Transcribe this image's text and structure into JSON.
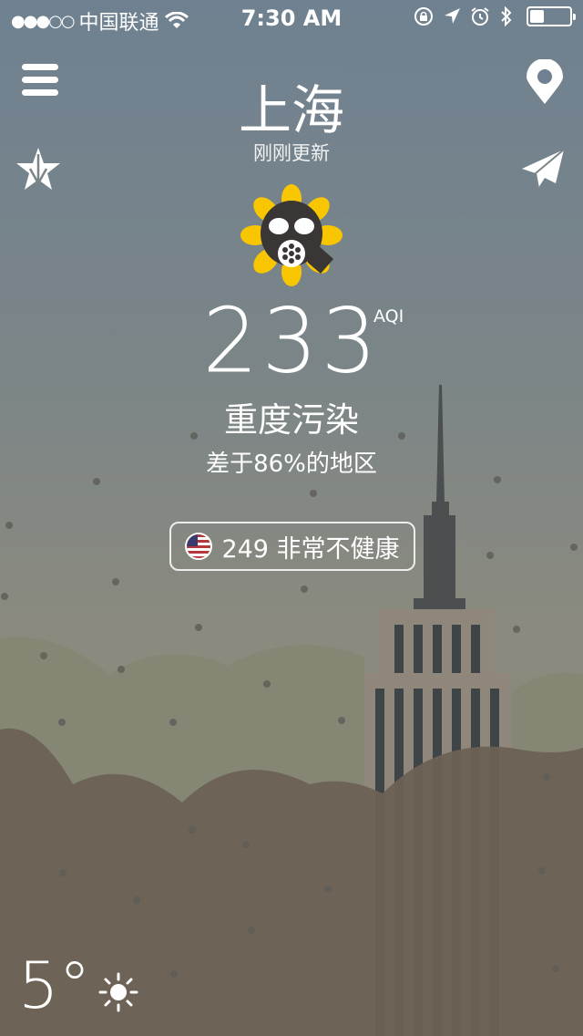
{
  "status": {
    "carrier": "中国联通",
    "time": "7:30 AM",
    "signal_dots": "●●●○○",
    "battery_percent": 35
  },
  "header": {
    "city": "上海",
    "updated": "刚刚更新"
  },
  "aqi": {
    "value": "233",
    "unit": "AQI",
    "level": "重度污染",
    "compare": "差于86%的地区"
  },
  "us_aqi": {
    "label": "249 非常不健康"
  },
  "weather": {
    "temperature": "5°"
  },
  "icons": {
    "menu": "hamburger-icon",
    "location": "map-pin-icon",
    "ranking": "star-icon",
    "share": "paper-plane-icon",
    "flag": "us-flag-icon",
    "weather": "sun-icon"
  },
  "colors": {
    "sky_top": "#6f8190",
    "haze": "#8a8a7e",
    "ground": "#6b6154",
    "mascot_petals": "#f7c600"
  }
}
